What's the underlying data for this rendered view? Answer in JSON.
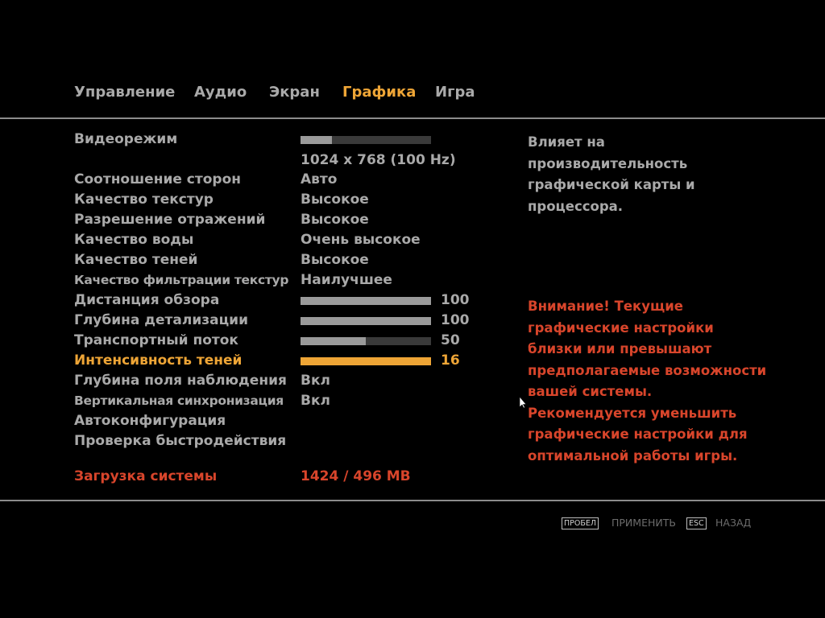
{
  "tabs": [
    {
      "label": "Управление"
    },
    {
      "label": "Аудио"
    },
    {
      "label": "Экран"
    },
    {
      "label": "Графика",
      "active": true
    },
    {
      "label": "Игра"
    }
  ],
  "settings": {
    "video_mode": {
      "label": "Видеорежим",
      "slider_fraction": 0.24,
      "value": "1024 x 768 (100 Hz)"
    },
    "aspect_ratio": {
      "label": "Соотношение сторон",
      "value": "Авто"
    },
    "texture_quality": {
      "label": "Качество текстур",
      "value": "Высокое"
    },
    "reflection_resolution": {
      "label": "Разрешение отражений",
      "value": "Высокое"
    },
    "water_quality": {
      "label": "Качество воды",
      "value": "Очень высокое"
    },
    "shadow_quality": {
      "label": "Качество теней",
      "value": "Высокое"
    },
    "texture_filter_quality": {
      "label": "Качество фильтрации текстур",
      "value": "Наилучшее"
    },
    "view_distance": {
      "label": "Дистанция обзора",
      "value": "100",
      "fraction": 1.0
    },
    "detail_distance": {
      "label": "Глубина детализации",
      "value": "100",
      "fraction": 1.0
    },
    "vehicle_density": {
      "label": "Транспортный поток",
      "value": "50",
      "fraction": 0.5
    },
    "shadow_density": {
      "label": "Интенсивность теней",
      "value": "16",
      "fraction": 1.0,
      "selected": true
    },
    "depth_of_field": {
      "label": "Глубина поля наблюдения",
      "value": "Вкл"
    },
    "vsync": {
      "label": "Вертикальная синхронизация",
      "value": "Вкл"
    },
    "auto_config": {
      "label": "Автоконфигурация"
    },
    "benchmark": {
      "label": "Проверка быстродействия"
    }
  },
  "system_load": {
    "label": "Загрузка системы",
    "value": "1424 / 496 MB"
  },
  "description": "Влияет на производительность графической карты и процессора.",
  "warning": "Внимание! Текущие графические настройки близки или превышают предполагаемые возможности вашей системы. Рекомендуется уменьшить графические настройки для оптимальной работы игры.",
  "footer": {
    "apply_key": "ПРОБЕЛ",
    "apply_label": "ПРИМЕНИТЬ",
    "back_key": "ESC",
    "back_label": "НАЗАД"
  },
  "colors": {
    "accent": "#eea536",
    "warning": "#d8452b",
    "text": "#a9a9a9",
    "background": "#000000"
  },
  "icons": {
    "cursor": "mouse-pointer-icon"
  }
}
